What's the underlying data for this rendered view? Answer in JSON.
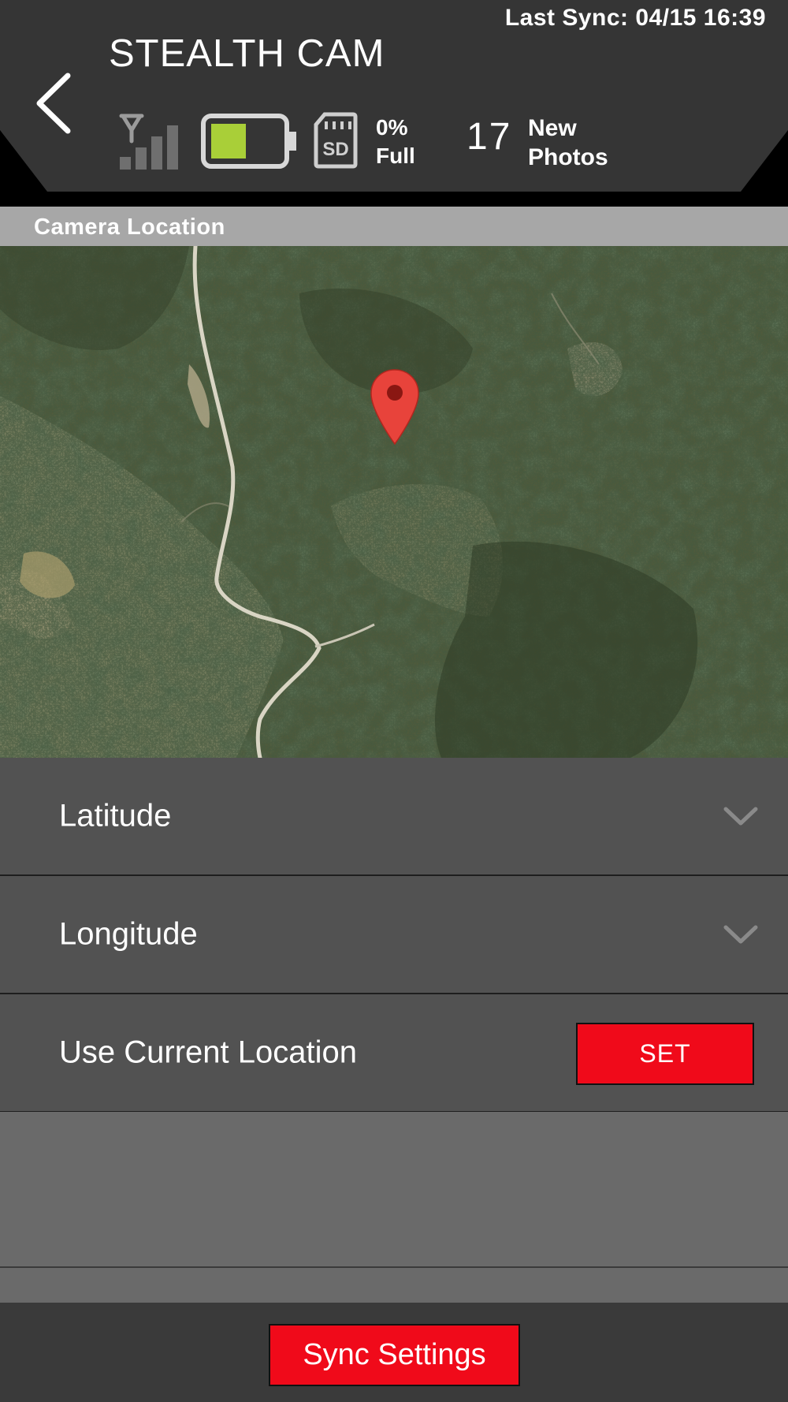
{
  "header": {
    "title": "STEALTH CAM",
    "last_sync": "Last Sync: 04/15 16:39",
    "storage_percent": "0%",
    "storage_label": "Full",
    "new_photos_count": "17",
    "new_photos_label_1": "New",
    "new_photos_label_2": "Photos",
    "sd_label": "SD",
    "battery_level": 0.45,
    "battery_color": "#a9cf38",
    "signal_bars_active": 0
  },
  "section": {
    "title": "Camera Location"
  },
  "map": {
    "marker_color": "#e8433b"
  },
  "rows": {
    "latitude_label": "Latitude",
    "longitude_label": "Longitude",
    "use_current_label": "Use Current Location",
    "set_label": "SET"
  },
  "footer": {
    "sync_label": "Sync Settings"
  },
  "colors": {
    "accent": "#f00a1a",
    "header_bg": "#353535",
    "row_bg": "#525252"
  }
}
